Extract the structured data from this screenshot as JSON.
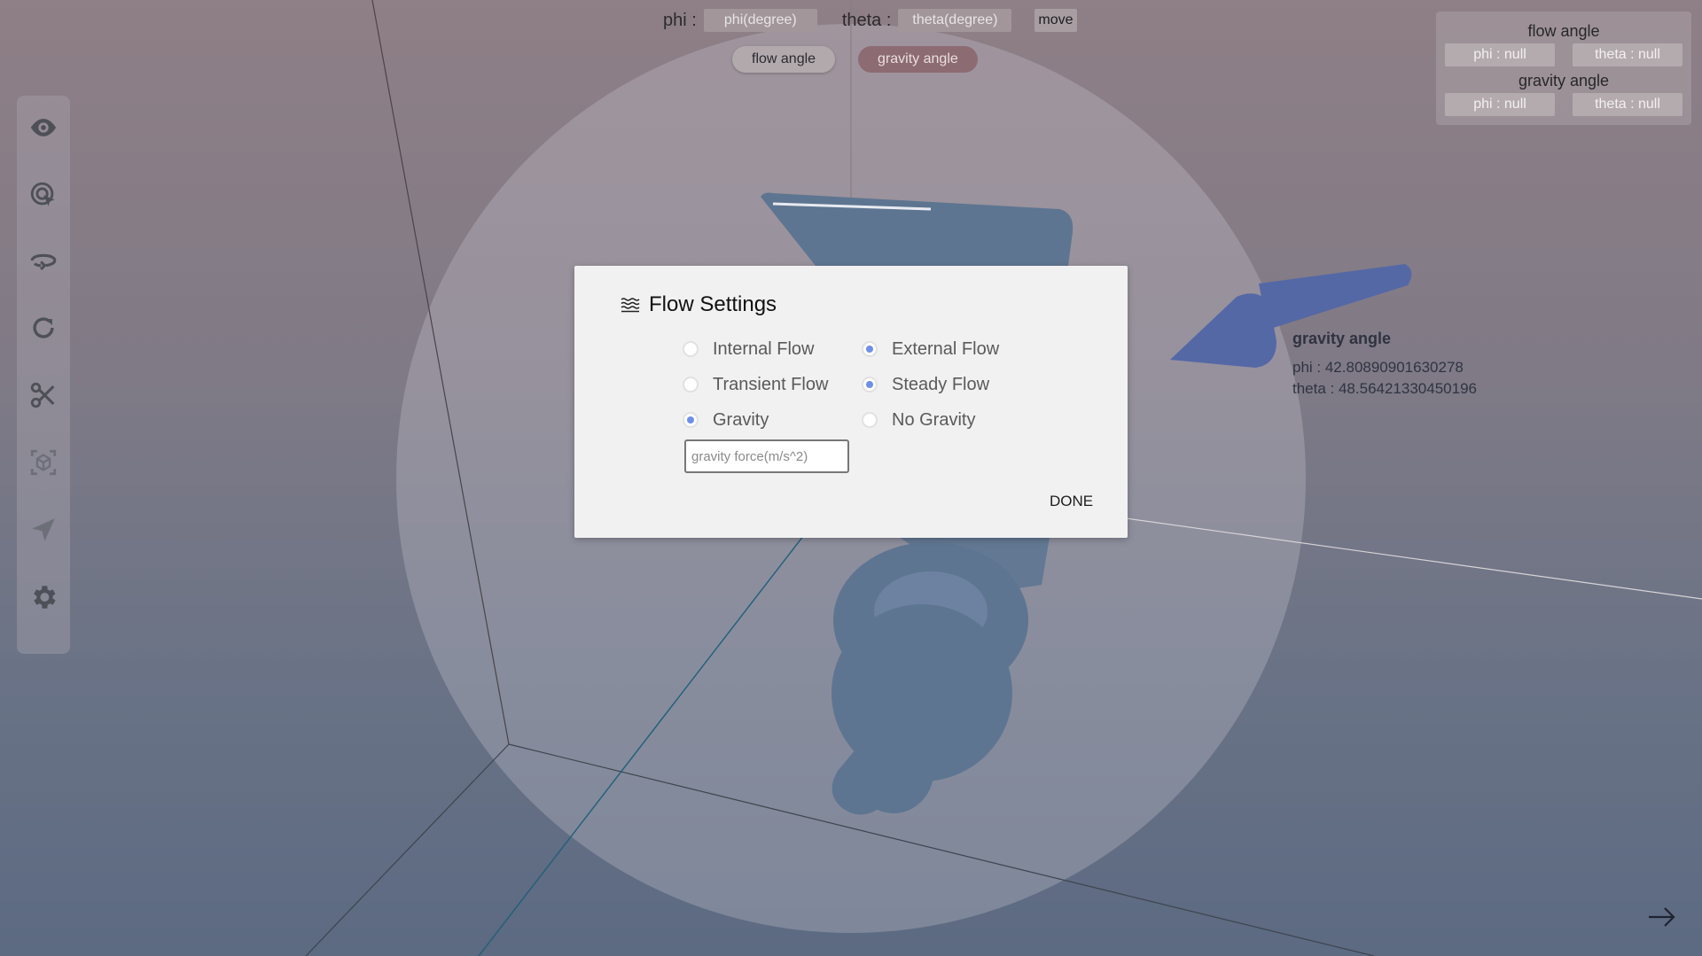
{
  "angle_controls": {
    "phi_label": "phi :",
    "phi_placeholder": "phi(degree)",
    "theta_label": "theta :",
    "theta_placeholder": "theta(degree)",
    "move_label": "move",
    "flow_angle_button": "flow angle",
    "gravity_angle_button": "gravity angle"
  },
  "info_panel": {
    "flow_title": "flow angle",
    "flow_phi": "phi : null",
    "flow_theta": "theta : null",
    "gravity_title": "gravity angle",
    "gravity_phi": "phi : null",
    "gravity_theta": "theta : null"
  },
  "toolbar": {
    "tools": [
      "eye-icon",
      "cursor-select-icon",
      "rotate-view-icon",
      "refresh-icon",
      "scissors-icon",
      "cube-focus-icon",
      "send-icon",
      "gear-icon"
    ]
  },
  "gravity_readout": {
    "title": "gravity angle",
    "phi": "phi : 42.80890901630278",
    "theta": "theta : 48.56421330450196"
  },
  "flow_settings": {
    "title": "Flow Settings",
    "options": {
      "internal": "Internal Flow",
      "external": "External Flow",
      "transient": "Transient Flow",
      "steady": "Steady Flow",
      "gravity": "Gravity",
      "no_gravity": "No Gravity"
    },
    "selected": [
      "External Flow",
      "Steady Flow",
      "Gravity"
    ],
    "gravity_force_placeholder": "gravity force(m/s^2)",
    "done_label": "DONE"
  },
  "colors": {
    "radio_selected": "#6e8fea",
    "model_color": "#5e7591",
    "gravity_arrow": "#5468a6"
  }
}
